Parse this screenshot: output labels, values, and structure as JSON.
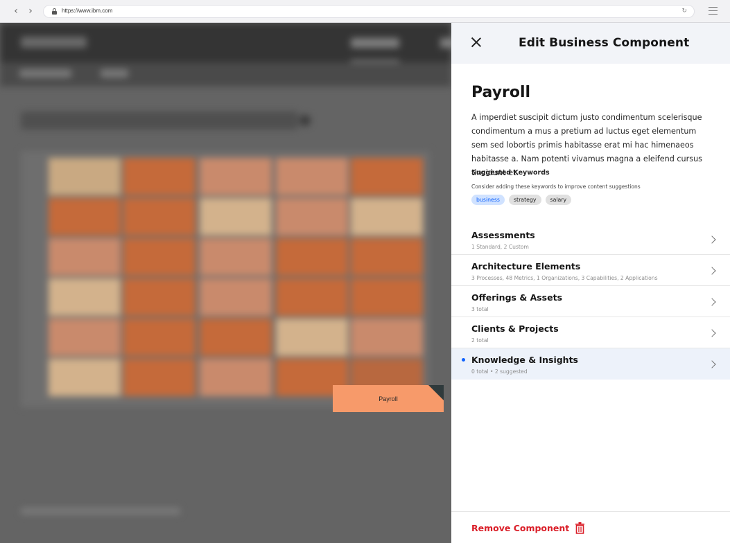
{
  "browser": {
    "url": "https://www.ibm.com",
    "back_icon": "chevron-left-icon",
    "forward_icon": "chevron-right-icon",
    "back_glyph": "‹",
    "forward_glyph": "›",
    "reload_glyph": "↻"
  },
  "background_card": {
    "label": "Payroll",
    "color": "#f79a6a"
  },
  "panel": {
    "title": "Edit Business Component",
    "component_name": "Payroll",
    "description": "A imperdiet suscipit dictum justo condimentum scelerisque condimentum a mus a pretium ad luctus eget elementum sem sed lobortis primis habitasse erat mi hac himenaeos habitasse a. Nam potenti vivamus magna a eleifend cursus tincidunt et.",
    "keywords": {
      "heading": "Suggested Keywords",
      "subtext": "Consider adding these keywords to improve content suggestions",
      "tags": [
        "business",
        "strategy",
        "salary"
      ]
    },
    "sections": [
      {
        "title": "Assessments",
        "subtitle": "1 Standard, 2 Custom"
      },
      {
        "title": "Architecture Elements",
        "subtitle": "3 Processes, 48 Metrics, 1 Organizations, 3 Capabilities, 2 Applications"
      },
      {
        "title": "Offerings & Assets",
        "subtitle": "3 total"
      },
      {
        "title": "Clients & Projects",
        "subtitle": "2 total"
      },
      {
        "title": "Knowledge & Insights",
        "subtitle": "0 total  • 2 suggested"
      }
    ],
    "remove_label": "Remove Component"
  },
  "colors": {
    "accent_blue": "#0f62fe",
    "danger_red": "#da1e28",
    "header_bg": "#f2f4f8"
  }
}
